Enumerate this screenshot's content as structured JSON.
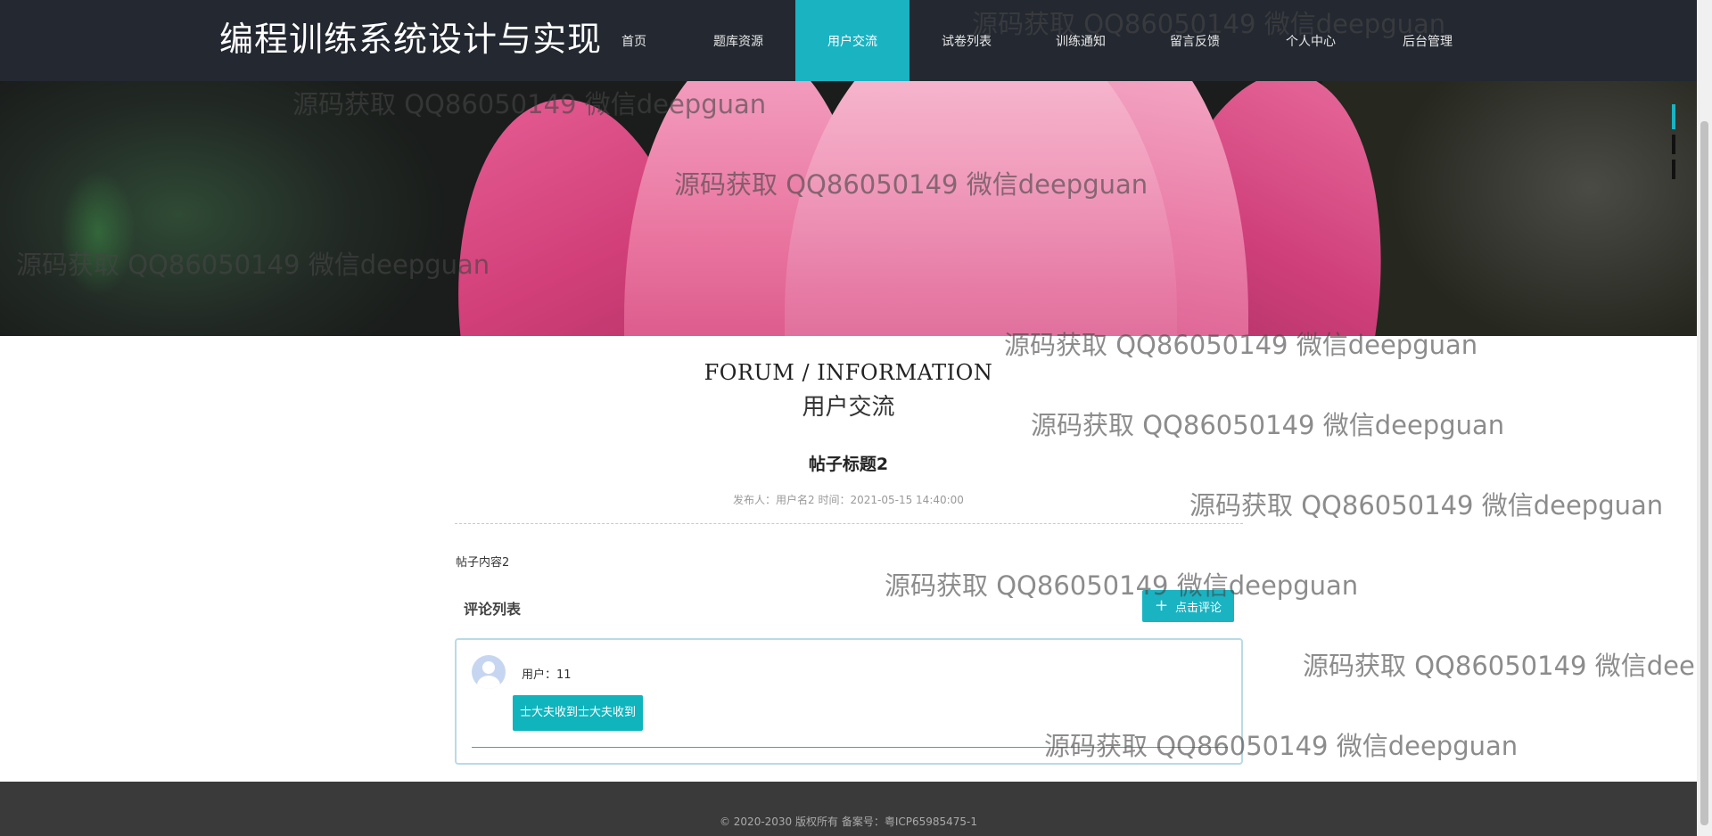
{
  "header": {
    "site_title": "编程训练系统设计与实现",
    "nav": [
      {
        "label": "首页"
      },
      {
        "label": "题库资源"
      },
      {
        "label": "用户交流",
        "active": true
      },
      {
        "label": "试卷列表"
      },
      {
        "label": "训练通知"
      },
      {
        "label": "留言反馈"
      },
      {
        "label": "个人中心"
      },
      {
        "label": "后台管理"
      }
    ]
  },
  "section": {
    "title_en": "FORUM / INFORMATION",
    "title_cn": "用户交流"
  },
  "post": {
    "title": "帖子标题2",
    "meta": "发布人：用户名2 时间：2021-05-15 14:40:00",
    "content": "帖子内容2"
  },
  "comments": {
    "title": "评论列表",
    "add_button": "点击评论",
    "items": [
      {
        "user": "用户：11",
        "text": "士大夫收到士大夫收到"
      }
    ]
  },
  "footer": {
    "text": "© 2020-2030 版权所有 备案号：粤ICP65985475-1"
  },
  "watermark": "源码获取 QQ86050149 微信deepguan",
  "colors": {
    "header_bg": "#232831",
    "accent": "#1ab3c2",
    "footer_bg": "#3a3a3a"
  }
}
